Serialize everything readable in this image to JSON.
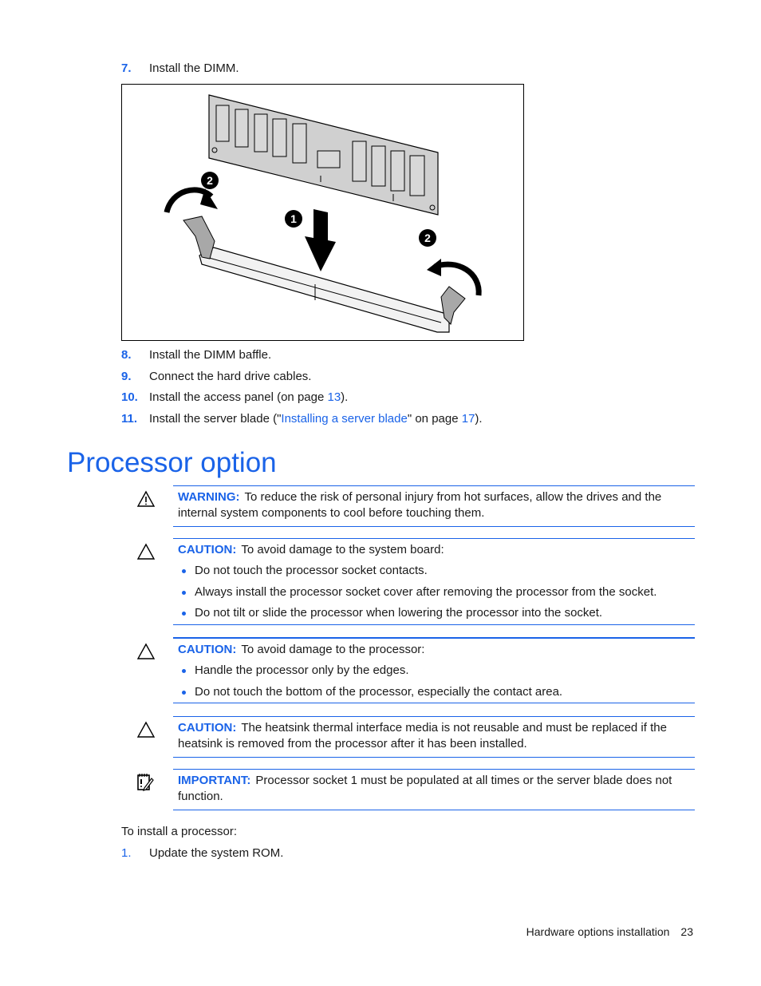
{
  "steps_top": [
    {
      "num": "7.",
      "text": "Install the DIMM."
    }
  ],
  "figure": {
    "description": "DIMM being inserted into slot with latches",
    "callouts": [
      "1",
      "2",
      "2"
    ]
  },
  "steps_mid": [
    {
      "num": "8.",
      "text": "Install the DIMM baffle."
    },
    {
      "num": "9.",
      "text": "Connect the hard drive cables."
    },
    {
      "num": "10.",
      "text_before": "Install the access panel (on page ",
      "link": "13",
      "text_after": ")."
    },
    {
      "num": "11.",
      "text_before": "Install the server blade (\"",
      "link": "Installing a server blade",
      "text_mid": "\" on page ",
      "link2": "17",
      "text_after": ")."
    }
  ],
  "section_title": "Processor option",
  "notes": [
    {
      "type": "warning",
      "icon": "warning-triangle-icon",
      "label": "WARNING:",
      "text": "To reduce the risk of personal injury from hot surfaces, allow the drives and the internal system components to cool before touching them.",
      "bullets": []
    },
    {
      "type": "caution",
      "icon": "caution-triangle-icon",
      "label": "CAUTION:",
      "text": "To avoid damage to the system board:",
      "bullets": [
        "Do not touch the processor socket contacts.",
        "Always install the processor socket cover after removing the processor from the socket.",
        "Do not tilt or slide the processor when lowering the processor into the socket."
      ]
    },
    {
      "type": "caution",
      "icon": "caution-triangle-icon",
      "label": "CAUTION:",
      "text": "To avoid damage to the processor:",
      "bullets": [
        "Handle the processor only by the edges.",
        "Do not touch the bottom of the processor, especially the contact area."
      ]
    },
    {
      "type": "caution",
      "icon": "caution-triangle-icon",
      "label": "CAUTION:",
      "text": "The heatsink thermal interface media is not reusable and must be replaced if the heatsink is removed from the processor after it has been installed.",
      "bullets": []
    },
    {
      "type": "important",
      "icon": "notepad-pencil-icon",
      "label": "IMPORTANT:",
      "text": "Processor socket 1 must be populated at all times or the server blade does not function.",
      "bullets": []
    }
  ],
  "intro": "To install a processor:",
  "steps_bottom": [
    {
      "num": "1.",
      "text": "Update the system ROM."
    }
  ],
  "footer": {
    "section": "Hardware options installation",
    "page": "23"
  },
  "colors": {
    "accent": "#1a63e8",
    "text": "#1a1a1a"
  }
}
